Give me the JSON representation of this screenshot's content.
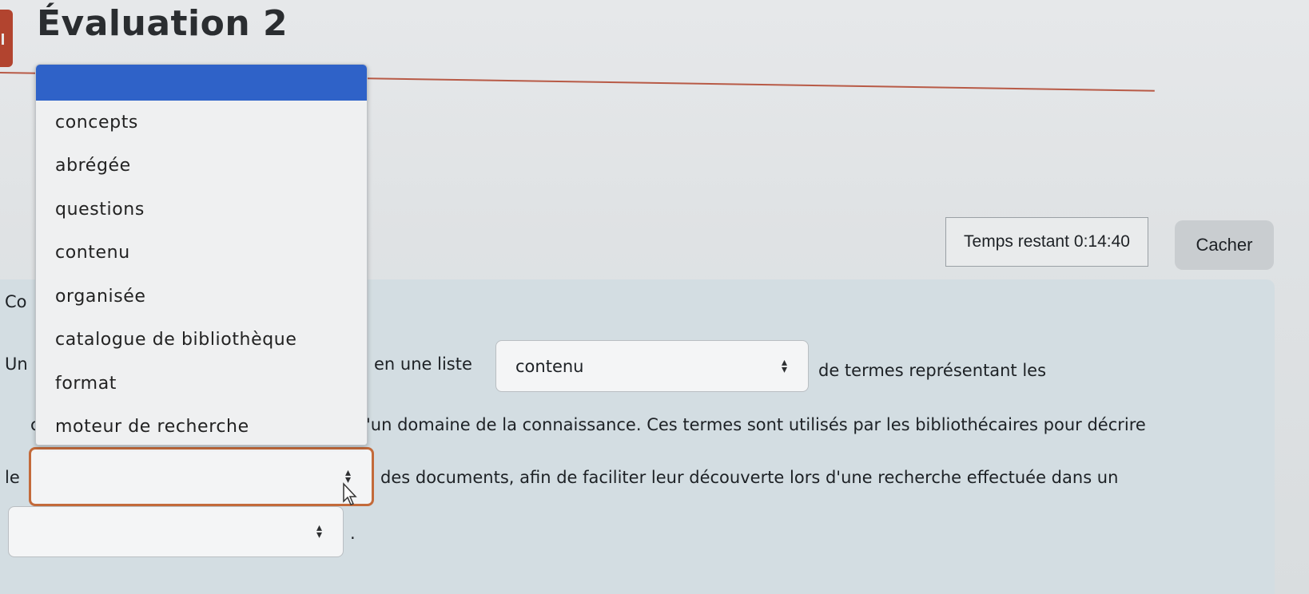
{
  "page": {
    "title": "Évaluation 2"
  },
  "timer": {
    "label": "Temps restant",
    "value": "0:14:40"
  },
  "hide_button": {
    "label": "Cacher"
  },
  "question": {
    "line1_start": "Co",
    "line2_start": "Un",
    "line2_middle": "en une liste",
    "line2_end": "de termes représentant les",
    "line3_start": "c",
    "line3_end": "'un domaine de la connaissance. Ces termes sont utilisés par les bibliothécaires pour décrire",
    "line4_start": "le",
    "line4_end": "des documents, afin de faciliter leur découverte lors d'une recherche effectuée dans un",
    "line5_end": "."
  },
  "selects": {
    "select_line2": {
      "value": "contenu"
    },
    "select_line4": {
      "value": ""
    },
    "select_line5": {
      "value": ""
    }
  },
  "dropdown": {
    "options": [
      "concepts",
      "abrégée",
      "questions",
      "contenu",
      "organisée",
      "catalogue de bibliothèque",
      "format",
      "moteur de recherche"
    ]
  },
  "colors": {
    "accent": "#b2442f",
    "highlight": "#2f62c8",
    "focus_border": "#c36a3a"
  }
}
